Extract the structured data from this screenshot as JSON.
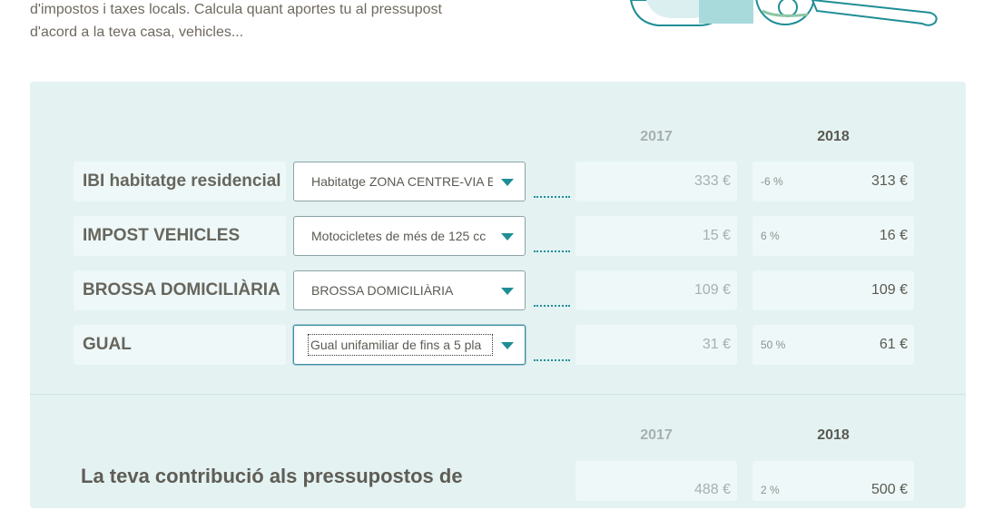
{
  "intro": {
    "line1": "d'impostos i taxes locals. Calcula quant aportes tu al pressupost",
    "line2": "d'acord a la teva casa, vehicles..."
  },
  "illustration": {
    "icon": "magnifying-glass-illustration"
  },
  "years": {
    "old": "2017",
    "new": "2018"
  },
  "rows": [
    {
      "label": "IBI habitatge residencial",
      "selected": "Habitatge ZONA CENTRE-VIA E",
      "v2017": "333 €",
      "pct": "-6 %",
      "v2018": "313 €"
    },
    {
      "label": "IMPOST VEHICLES",
      "selected": "Motocicletes de més de 125 cc",
      "v2017": "15 €",
      "pct": "6 %",
      "v2018": "16 €"
    },
    {
      "label": "BROSSA DOMICILIÀRIA",
      "selected": "BROSSA DOMICILIÀRIA",
      "v2017": "109 €",
      "pct": "",
      "v2018": "109 €"
    },
    {
      "label": "GUAL",
      "selected": "Gual unifamiliar de fins a 5 pla",
      "v2017": "31 €",
      "pct": "50 %",
      "v2018": "61 €"
    }
  ],
  "total": {
    "title": "La teva contribució als pressupostos de",
    "v2017": "488 €",
    "pct": "2 %",
    "v2018": "500 €"
  },
  "colors": {
    "panel": "#e4f2f2",
    "accent": "#1f8e96"
  }
}
